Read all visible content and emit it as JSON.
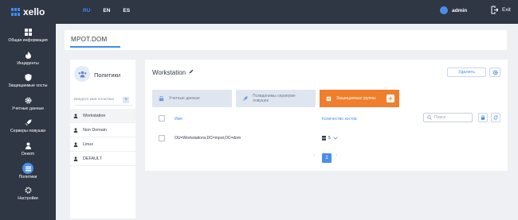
{
  "header": {
    "logo": "xello",
    "languages": [
      {
        "code": "RU",
        "active": true
      },
      {
        "code": "EN",
        "active": false
      },
      {
        "code": "ES",
        "active": false
      }
    ],
    "user": "admin",
    "exit_label": "Exit"
  },
  "sidebar": {
    "items": [
      {
        "label": "Общая информация",
        "icon": "dashboard-icon"
      },
      {
        "label": "Инциденты",
        "icon": "fire-icon"
      },
      {
        "label": "Защищаемые хосты",
        "icon": "shield-icon"
      },
      {
        "label": "Учетные данные",
        "icon": "gear-icon"
      },
      {
        "label": "Серверы-ловушки",
        "icon": "rocket-icon"
      },
      {
        "label": "Deкem",
        "icon": "user-icon"
      },
      {
        "label": "Политики",
        "icon": "policies-icon",
        "active": true
      },
      {
        "label": "Настройки",
        "icon": "settings-icon"
      }
    ]
  },
  "domain": {
    "tab": "MPOT.DOM"
  },
  "policies_panel": {
    "title": "Политики",
    "filter_placeholder": "Введите имя политики",
    "items": [
      {
        "label": "Workstation",
        "active": true
      },
      {
        "label": "Non Domain"
      },
      {
        "label": "Linux"
      },
      {
        "label": "DEFAULT"
      }
    ]
  },
  "policy_detail": {
    "title": "Workstation",
    "delete_label": "Удалить",
    "tabs": [
      {
        "label": "Учетные данные",
        "icon": "key-icon"
      },
      {
        "label": "Псевдонимы серверов-ловушек",
        "icon": "rocket-icon"
      },
      {
        "label": "Защищаемые группы",
        "icon": "folder-icon",
        "active": true
      }
    ],
    "table": {
      "columns": [
        "Имя",
        "Количество хостов"
      ],
      "search_placeholder": "Поиск",
      "rows": [
        {
          "name": "OU=Workstations,DC=mpot,DC=dom",
          "hosts": "5"
        }
      ]
    },
    "pagination": {
      "prev": "‹",
      "current": "1",
      "next": "›"
    }
  },
  "colors": {
    "accent": "#4a8fe7",
    "active_tab": "#f07e2c",
    "sidebar": "#2f3644"
  }
}
